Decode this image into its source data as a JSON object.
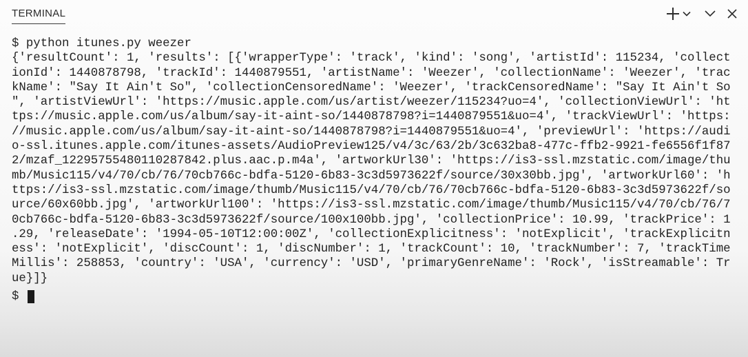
{
  "panel": {
    "tab_label": "TERMINAL",
    "actions": [
      {
        "name": "new-terminal-button",
        "icon": "plus-icon"
      },
      {
        "name": "terminal-dropdown-button",
        "icon": "chevron-down-icon"
      },
      {
        "name": "maximize-panel-button",
        "icon": "chevron-down-icon"
      },
      {
        "name": "close-panel-button",
        "icon": "close-icon"
      }
    ]
  },
  "terminal": {
    "lines": [
      "$ python itunes.py weezer",
      "{'resultCount': 1, 'results': [{'wrapperType': 'track', 'kind': 'song', 'artistId': 115234, 'collect",
      "ionId': 1440878798, 'trackId': 1440879551, 'artistName': 'Weezer', 'collectionName': 'Weezer', 'trac",
      "kName': \"Say It Ain't So\", 'collectionCensoredName': 'Weezer', 'trackCensoredName': \"Say It Ain't So",
      "\", 'artistViewUrl': 'https://music.apple.com/us/artist/weezer/115234?uo=4', 'collectionViewUrl': 'ht",
      "tps://music.apple.com/us/album/say-it-aint-so/1440878798?i=1440879551&uo=4', 'trackViewUrl': 'https:",
      "//music.apple.com/us/album/say-it-aint-so/1440878798?i=1440879551&uo=4', 'previewUrl': 'https://audi",
      "o-ssl.itunes.apple.com/itunes-assets/AudioPreview125/v4/3c/63/2b/3c632ba8-477c-ffb2-9921-fe6556f1f87",
      "2/mzaf_12295755480110287842.plus.aac.p.m4a', 'artworkUrl30': 'https://is3-ssl.mzstatic.com/image/thu",
      "mb/Music115/v4/70/cb/76/70cb766c-bdfa-5120-6b83-3c3d5973622f/source/30x30bb.jpg', 'artworkUrl60': 'h",
      "ttps://is3-ssl.mzstatic.com/image/thumb/Music115/v4/70/cb/76/70cb766c-bdfa-5120-6b83-3c3d5973622f/so",
      "urce/60x60bb.jpg', 'artworkUrl100': 'https://is3-ssl.mzstatic.com/image/thumb/Music115/v4/70/cb/76/7",
      "0cb766c-bdfa-5120-6b83-3c3d5973622f/source/100x100bb.jpg', 'collectionPrice': 10.99, 'trackPrice': 1",
      ".29, 'releaseDate': '1994-05-10T12:00:00Z', 'collectionExplicitness': 'notExplicit', 'trackExplicitn",
      "ess': 'notExplicit', 'discCount': 1, 'discNumber': 1, 'trackCount': 10, 'trackNumber': 7, 'trackTime",
      "Millis': 258853, 'country': 'USA', 'currency': 'USD', 'primaryGenreName': 'Rock', 'isStreamable': Tr",
      "ue}]}"
    ],
    "prompt": "$ "
  },
  "colors": {
    "text": "#232323",
    "tab_underline": "#3a3a3a",
    "background": "#fbfbfb"
  }
}
